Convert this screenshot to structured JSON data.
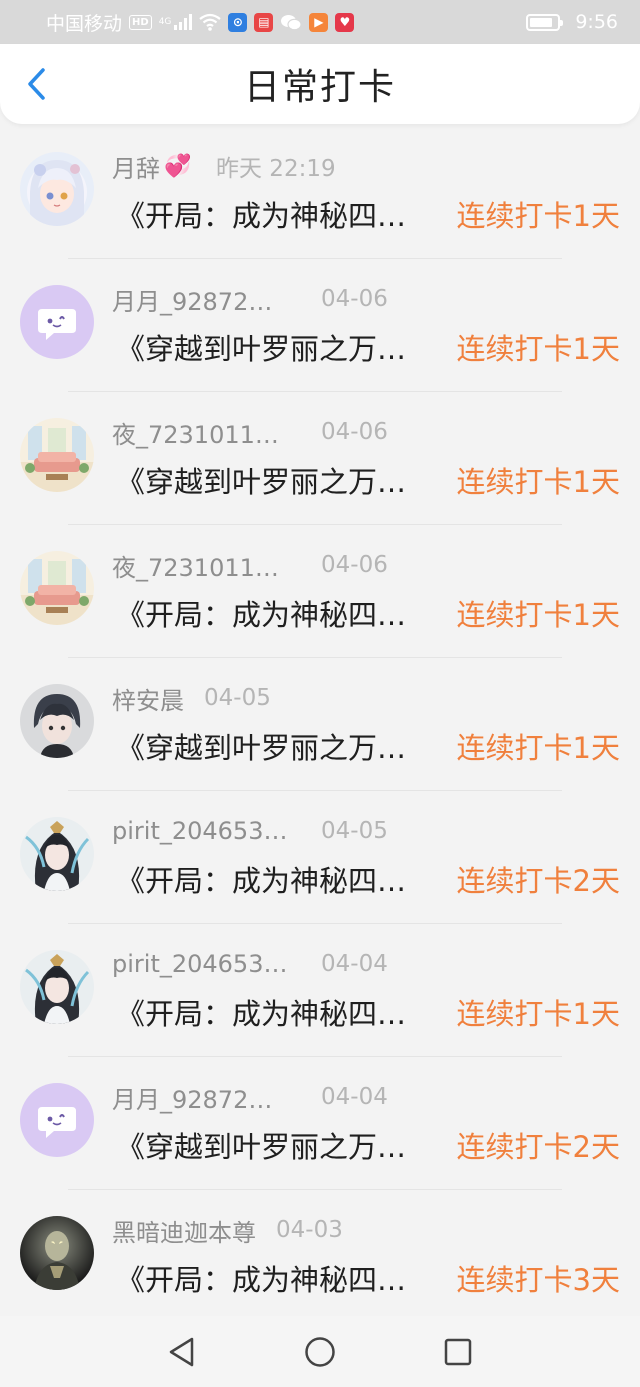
{
  "status_bar": {
    "carrier": "中国移动",
    "hd_badge": "HD",
    "network": "4G",
    "time": "9:56",
    "battery_level": 0.85
  },
  "header": {
    "title": "日常打卡",
    "back_icon": "chevron-left-icon"
  },
  "accent_color": "#f0803d",
  "items": [
    {
      "username": "月辞",
      "time": "昨天 22:19",
      "book": "《开局：成为神秘四…",
      "streak": "连续打卡1天",
      "avatar": "anime-girl-white"
    },
    {
      "username": "月月_92872…",
      "time": "04-06",
      "book": "《穿越到叶罗丽之万…",
      "streak": "连续打卡1天",
      "avatar": "default-purple"
    },
    {
      "username": "夜_7231011…",
      "time": "04-06",
      "book": "《穿越到叶罗丽之万…",
      "streak": "连续打卡1天",
      "avatar": "room-scene"
    },
    {
      "username": "夜_7231011…",
      "time": "04-06",
      "book": "《开局：成为神秘四…",
      "streak": "连续打卡1天",
      "avatar": "room-scene"
    },
    {
      "username": "梓安晨",
      "time": "04-05",
      "book": "《穿越到叶罗丽之万…",
      "streak": "连续打卡1天",
      "avatar": "anime-boy-dark"
    },
    {
      "username": "pirit_204653…",
      "time": "04-05",
      "book": "《开局：成为神秘四…",
      "streak": "连续打卡2天",
      "avatar": "ancient-character"
    },
    {
      "username": "pirit_204653…",
      "time": "04-04",
      "book": "《开局：成为神秘四…",
      "streak": "连续打卡1天",
      "avatar": "ancient-character"
    },
    {
      "username": "月月_92872…",
      "time": "04-04",
      "book": "《穿越到叶罗丽之万…",
      "streak": "连续打卡2天",
      "avatar": "default-purple"
    },
    {
      "username": "黑暗迪迦本尊",
      "time": "04-03",
      "book": "《开局：成为神秘四…",
      "streak": "连续打卡3天",
      "avatar": "dark-hero"
    }
  ],
  "nav_bar": {
    "back": "triangle-back-icon",
    "home": "circle-home-icon",
    "recents": "square-recents-icon"
  }
}
